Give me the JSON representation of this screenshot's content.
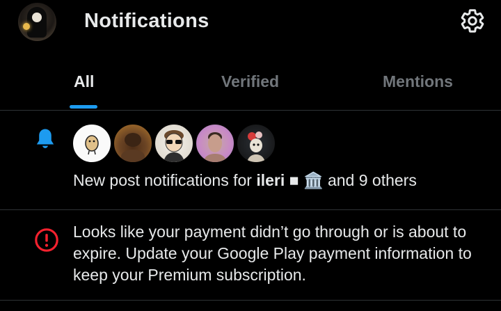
{
  "header": {
    "title": "Notifications",
    "avatar_icon": "profile-avatar",
    "settings_icon": "gear-icon"
  },
  "tabs": [
    {
      "label": "All",
      "active": true
    },
    {
      "label": "Verified",
      "active": false
    },
    {
      "label": "Mentions",
      "active": false
    }
  ],
  "colors": {
    "accent": "#1d9bf0",
    "alert": "#f4212e",
    "background": "#000000",
    "text": "#e7e9ea",
    "muted": "#71767b",
    "divider": "#2f3336"
  },
  "notifications": [
    {
      "type": "new-post",
      "icon": "bell-icon",
      "prefix": "New post notifications for ",
      "username": "ileri",
      "emoji": " ■ 🏛️",
      "suffix": " and 9 others",
      "avatar_count": 5
    },
    {
      "type": "payment-alert",
      "icon": "alert-circle-icon",
      "text": "Looks like your payment didn’t go through or is about to expire. Update your Google Play payment information to keep your Premium subscription."
    }
  ]
}
